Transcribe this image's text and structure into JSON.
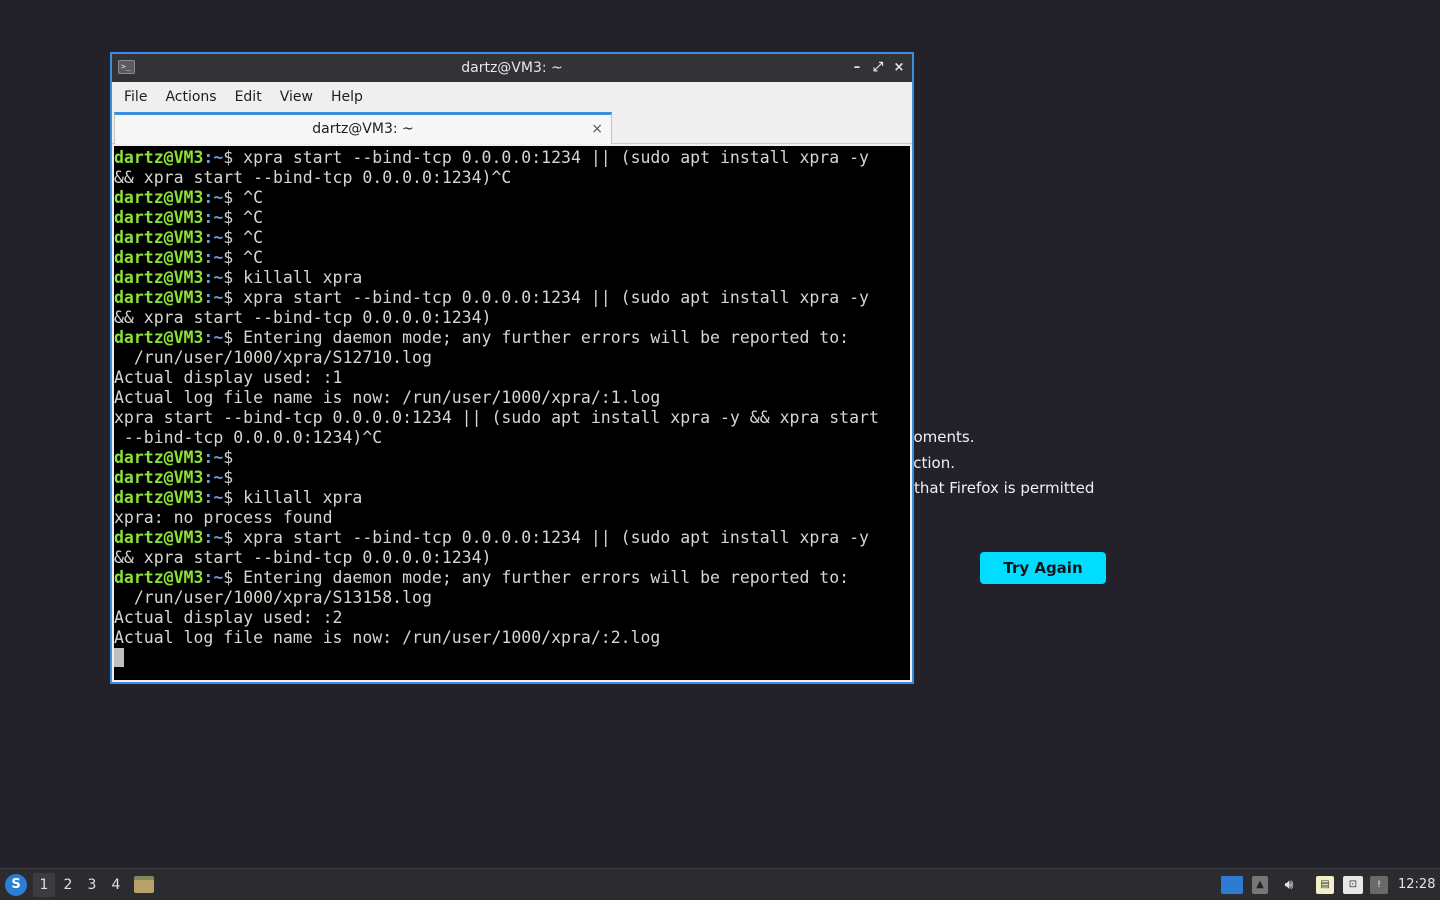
{
  "background_page": {
    "lines": [
      "noments.",
      "ection.",
      "that Firefox is permitted"
    ],
    "try_again_label": "Try Again"
  },
  "window": {
    "title": "dartz@VM3: ~",
    "menu": [
      "File",
      "Actions",
      "Edit",
      "View",
      "Help"
    ],
    "tab_label": "dartz@VM3: ~",
    "tab_close": "×",
    "controls": {
      "minimize": "–",
      "maximize": "⤢",
      "close": "×"
    }
  },
  "terminal": {
    "prompt_user": "dartz@VM3",
    "prompt_path": ":~",
    "lines": [
      {
        "prompt": true,
        "text": "$ xpra start --bind-tcp 0.0.0.0:1234 || (sudo apt install xpra -y"
      },
      {
        "prompt": false,
        "text": "&& xpra start --bind-tcp 0.0.0.0:1234)^C"
      },
      {
        "prompt": true,
        "text": "$ ^C"
      },
      {
        "prompt": true,
        "text": "$ ^C"
      },
      {
        "prompt": true,
        "text": "$ ^C"
      },
      {
        "prompt": true,
        "text": "$ ^C"
      },
      {
        "prompt": true,
        "text": "$ killall xpra"
      },
      {
        "prompt": true,
        "text": "$ xpra start --bind-tcp 0.0.0.0:1234 || (sudo apt install xpra -y"
      },
      {
        "prompt": false,
        "text": "&& xpra start --bind-tcp 0.0.0.0:1234)"
      },
      {
        "prompt": true,
        "text": "$ Entering daemon mode; any further errors will be reported to:"
      },
      {
        "prompt": false,
        "text": "  /run/user/1000/xpra/S12710.log"
      },
      {
        "prompt": false,
        "text": "Actual display used: :1"
      },
      {
        "prompt": false,
        "text": "Actual log file name is now: /run/user/1000/xpra/:1.log"
      },
      {
        "prompt": false,
        "text": "xpra start --bind-tcp 0.0.0.0:1234 || (sudo apt install xpra -y && xpra start"
      },
      {
        "prompt": false,
        "text": " --bind-tcp 0.0.0.0:1234)^C"
      },
      {
        "prompt": true,
        "text": "$"
      },
      {
        "prompt": true,
        "text": "$"
      },
      {
        "prompt": true,
        "text": "$ killall xpra"
      },
      {
        "prompt": false,
        "text": "xpra: no process found"
      },
      {
        "prompt": true,
        "text": "$ xpra start --bind-tcp 0.0.0.0:1234 || (sudo apt install xpra -y"
      },
      {
        "prompt": false,
        "text": "&& xpra start --bind-tcp 0.0.0.0:1234)"
      },
      {
        "prompt": true,
        "text": "$ Entering daemon mode; any further errors will be reported to:"
      },
      {
        "prompt": false,
        "text": "  /run/user/1000/xpra/S13158.log"
      },
      {
        "prompt": false,
        "text": "Actual display used: :2"
      },
      {
        "prompt": false,
        "text": "Actual log file name is now: /run/user/1000/xpra/:2.log"
      }
    ]
  },
  "taskbar": {
    "workspaces": [
      "1",
      "2",
      "3",
      "4"
    ],
    "active_workspace": "1",
    "clock": "12:28"
  }
}
